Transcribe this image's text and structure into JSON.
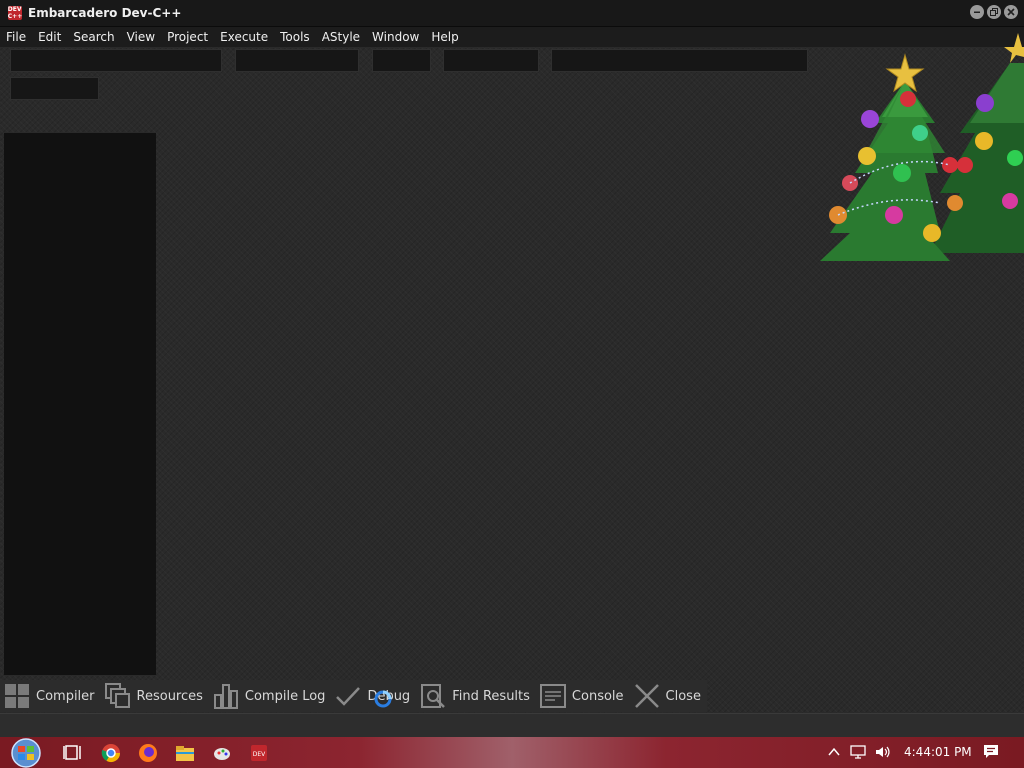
{
  "window": {
    "title": "Embarcadero Dev-C++",
    "app_icon_text": "DEV C++"
  },
  "menu": [
    "File",
    "Edit",
    "Search",
    "View",
    "Project",
    "Execute",
    "Tools",
    "AStyle",
    "Window",
    "Help"
  ],
  "bottom_tabs": [
    {
      "label": "Compiler",
      "icon": "grid-icon"
    },
    {
      "label": "Resources",
      "icon": "resources-icon"
    },
    {
      "label": "Compile Log",
      "icon": "bar-chart-icon"
    },
    {
      "label": "Debug",
      "icon": "check-icon"
    },
    {
      "label": "Find Results",
      "icon": "find-icon"
    },
    {
      "label": "Console",
      "icon": "console-icon"
    },
    {
      "label": "Close",
      "icon": "close-icon"
    }
  ],
  "taskbar": {
    "clock": "4:44:01 PM",
    "apps": [
      "start-orb-icon",
      "task-view-icon",
      "chrome-icon",
      "firefox-icon",
      "file-explorer-icon",
      "paint-icon",
      "devcpp-icon"
    ]
  }
}
